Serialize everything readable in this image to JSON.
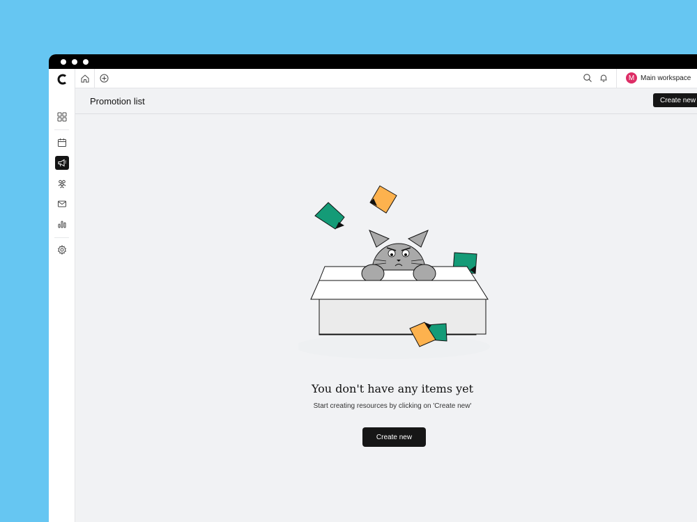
{
  "window": {
    "titlebar_dots": [
      "dot-1",
      "dot-2",
      "dot-3"
    ]
  },
  "sidebar": {
    "logo_icon": "app-logo",
    "items": [
      {
        "name": "dashboard",
        "icon": "grid-icon",
        "active": false
      },
      {
        "name": "calendar",
        "icon": "calendar-icon",
        "active": false
      },
      {
        "name": "promotions",
        "icon": "megaphone-icon",
        "active": true
      },
      {
        "name": "audience",
        "icon": "people-icon",
        "active": false
      },
      {
        "name": "messages",
        "icon": "mail-icon",
        "active": false
      },
      {
        "name": "analytics",
        "icon": "bar-chart-icon",
        "active": false
      },
      {
        "name": "settings",
        "icon": "gear-icon",
        "active": false
      }
    ]
  },
  "topbar": {
    "home_icon": "home-icon",
    "add_icon": "add-tab-icon",
    "search_icon": "search-icon",
    "notification_icon": "bell-icon",
    "workspace": {
      "avatar_initial": "M",
      "avatar_color": "#dd2d66",
      "name": "Main workspace"
    }
  },
  "header": {
    "title": "Promotion list",
    "create_button": "Create new"
  },
  "empty_state": {
    "title": "You don't have any items yet",
    "subtitle": "Start creating resources by clicking on 'Create new'",
    "button": "Create new"
  },
  "colors": {
    "background": "#66c6f2",
    "content_bg": "#f1f2f4",
    "dark_button": "#161616",
    "paper_orange": "#fdb24e",
    "paper_green": "#149b77",
    "cat_gray": "#a9a9a9"
  }
}
